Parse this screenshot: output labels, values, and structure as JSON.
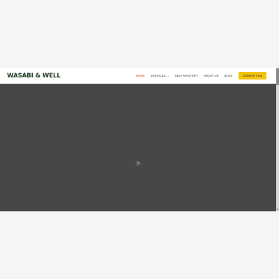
{
  "header": {
    "logo_text": "WASABI & WELL"
  },
  "nav": {
    "items": [
      {
        "label": "HOME",
        "active": true
      },
      {
        "label": "SERVICES",
        "has_dropdown": true
      },
      {
        "label": "SELF-MASTERY"
      },
      {
        "label": "ABOUT US"
      },
      {
        "label": "BLOG"
      }
    ],
    "contact_label": "CONTACT US"
  },
  "colors": {
    "logo": "#1d3a20",
    "active_nav": "#d3453b",
    "contact_button": "#f3c30e",
    "hero_background": "#474747"
  },
  "icons": {
    "dropdown": "chevron-down-icon",
    "loading": "spinner-icon",
    "scroll_down": "scroll-down-arrow-icon"
  }
}
